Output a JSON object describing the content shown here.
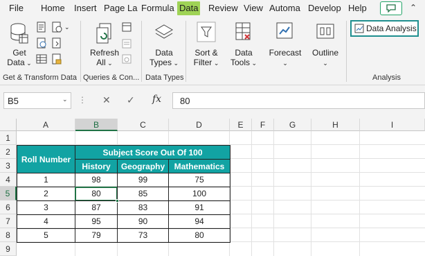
{
  "tabs": [
    "File",
    "Home",
    "Insert",
    "Page La",
    "Formula",
    "Data",
    "Review",
    "View",
    "Automa",
    "Develop",
    "Help"
  ],
  "ribbon": {
    "get_data": "Get\nData",
    "get_data_l1": "Get",
    "get_data_l2": "Data",
    "refresh_l1": "Refresh",
    "refresh_l2": "All",
    "data_types_l1": "Data",
    "data_types_l2": "Types",
    "sort_filter_l1": "Sort &",
    "sort_filter_l2": "Filter",
    "data_tools_l1": "Data",
    "data_tools_l2": "Tools",
    "forecast": "Forecast",
    "outline": "Outline",
    "data_analysis": "Data Analysis",
    "groups": [
      "Get & Transform Data",
      "Queries & Con...",
      "Data Types",
      "Analysis"
    ]
  },
  "formula_bar": {
    "name_box": "B5",
    "fx": "fx",
    "value": "80"
  },
  "columns": [
    "A",
    "B",
    "C",
    "D",
    "E",
    "F",
    "G",
    "H",
    "I"
  ],
  "rows": [
    "1",
    "2",
    "3",
    "4",
    "5",
    "6",
    "7",
    "8",
    "9"
  ],
  "table": {
    "roll_header": "Roll Number",
    "group_header": "Subject Score Out Of 100",
    "sub_headers": [
      "History",
      "Geography",
      "Mathematics"
    ],
    "data": [
      [
        "1",
        "98",
        "99",
        "75"
      ],
      [
        "2",
        "80",
        "85",
        "100"
      ],
      [
        "3",
        "87",
        "83",
        "91"
      ],
      [
        "4",
        "95",
        "90",
        "94"
      ],
      [
        "5",
        "79",
        "73",
        "80"
      ]
    ]
  },
  "colors": {
    "accent": "#9fd356",
    "header_fill": "#12a3a3",
    "excel_green": "#217346"
  }
}
